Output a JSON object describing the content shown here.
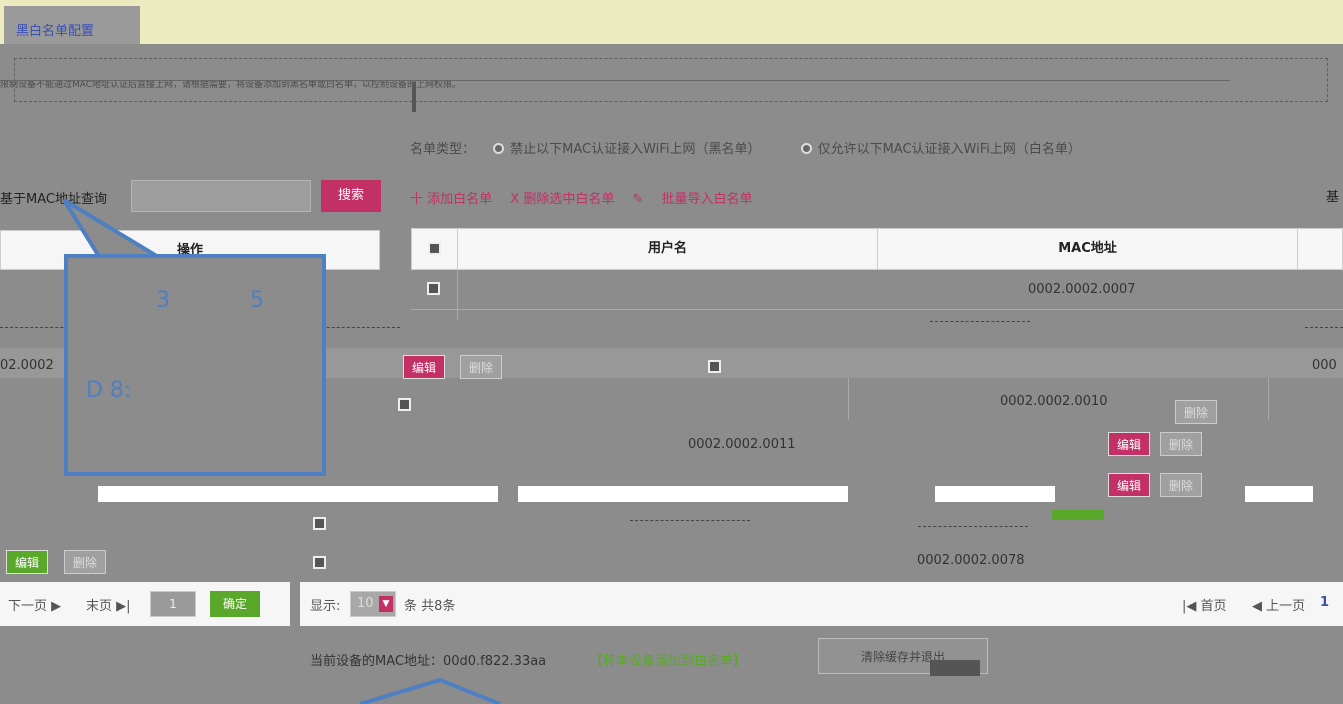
{
  "tab": {
    "label": "黑白名单配置"
  },
  "notice": {
    "text": "限制设备不能通过MAC地址认证后直接上网，请根据需要，将设备添加到黑名单或白名单，以控制设备的上网权限。"
  },
  "list_type": {
    "label": "名单类型：",
    "option_black": "禁止以下MAC认证接入WiFi上网（黑名单）",
    "option_white": "仅允许以下MAC认证接入WiFi上网（白名单）"
  },
  "search": {
    "label": "基于MAC地址查询",
    "placeholder": "",
    "button": "搜索"
  },
  "actions": {
    "add": "十 添加白名单",
    "delete": "X 删除选中白名单",
    "import": "批量导入白名单",
    "corner": "基"
  },
  "left_table": {
    "header_ops": "操作",
    "row_mac": "02.0002",
    "edit": "编辑",
    "del": "删除"
  },
  "table": {
    "headers": {
      "username": "用户名",
      "mac": "MAC地址"
    },
    "rows": [
      {
        "mac": "0002.0002.0007"
      },
      {
        "mac": "0002.0002.0010"
      },
      {
        "mac": "0002.0002.0011"
      },
      {
        "mac": "0002.0002.0078"
      }
    ],
    "edit": "编辑",
    "del": "删除",
    "right_cut": "000"
  },
  "pager_left": {
    "next": "下一页 ▶",
    "last": "末页 ▶|",
    "page_value": "1",
    "go": "确定"
  },
  "pager_right": {
    "show_label": "显示:",
    "per_page": "10",
    "suffix": "条 共8条",
    "first": "|◀ 首页",
    "prev": "◀ 上一页",
    "current": "1"
  },
  "footer": {
    "text": "当前设备的MAC地址：00d0.f822.33aa",
    "link": "【将本设备添加到白名单】",
    "button": "清除缓存并退出"
  },
  "callout": {
    "n1": "3",
    "n2": "5",
    "n3": "D 8:"
  }
}
